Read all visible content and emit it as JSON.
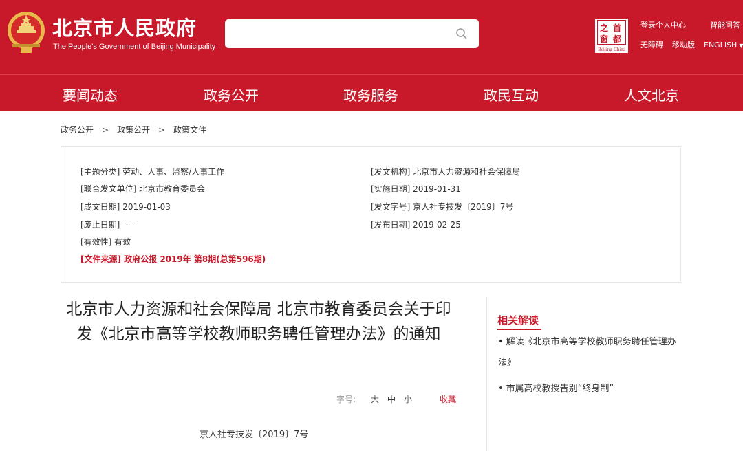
{
  "header": {
    "site_title": "北京市人民政府",
    "site_subtitle": "The People's Government of Beijing Municipality",
    "search_placeholder": "",
    "capital_logo": {
      "chars": [
        "之",
        "首",
        "窗",
        "都"
      ],
      "caption": "Beijing-China"
    },
    "links": {
      "login": "登录个人中心",
      "smart_qa": "智能问答",
      "accessibility": "无障碍",
      "mobile": "移动版",
      "english": "ENGLISH"
    }
  },
  "nav": {
    "items": [
      "要闻动态",
      "政务公开",
      "政务服务",
      "政民互动",
      "人文北京"
    ]
  },
  "breadcrumb": [
    "政务公开",
    "政策公开",
    "政策文件"
  ],
  "breadcrumb_sep": ">",
  "meta": {
    "topic": "[主题分类] 劳动、人事、监察/人事工作",
    "issuer": "[发文机构] 北京市人力资源和社会保障局",
    "joint_issuer": "[联合发文单位] 北京市教育委员会",
    "effective_date": "[实施日期] 2019-01-31",
    "written_date": "[成文日期] 2019-01-03",
    "doc_number": "[发文字号] 京人社专技发〔2019〕7号",
    "abolish_date": "[废止日期] ----",
    "publish_date": "[发布日期] 2019-02-25",
    "validity": "[有效性] 有效",
    "source": "[文件来源] 政府公报 2019年 第8期(总第596期)"
  },
  "article": {
    "title": "北京市人力资源和社会保障局 北京市教育委员会关于印发《北京市高等学校教师职务聘任管理办法》的通知",
    "font_size_label": "字号:",
    "size_large": "大",
    "size_medium": "中",
    "size_small": "小",
    "favorite": "收藏",
    "doc_number": "京人社专技发〔2019〕7号"
  },
  "sidebar": {
    "related_title": "相关解读",
    "related_items": [
      "解读《北京市高等学校教师职务聘任管理办法》",
      "市属高校教授告别“终身制”"
    ]
  },
  "colors": {
    "brand_red": "#c8192b",
    "toolbar_gray": "#999999"
  }
}
